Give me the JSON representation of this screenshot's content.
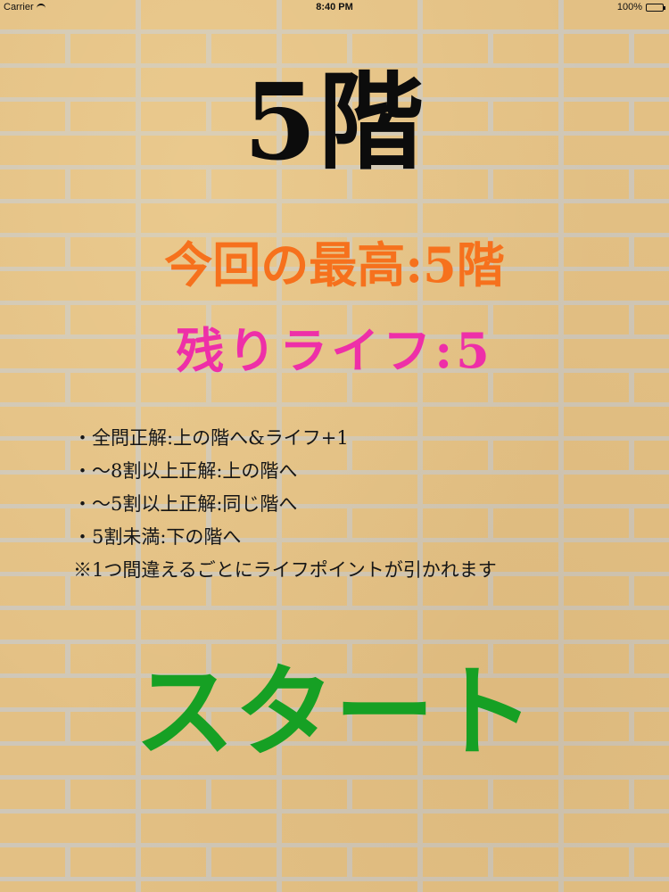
{
  "status_bar": {
    "carrier": "Carrier",
    "time": "8:40 PM",
    "battery": "100%"
  },
  "current_floor": "5階",
  "best_record": "今回の最高:5階",
  "remaining_life": "残りライフ:5",
  "rules": [
    "・全問正解:上の階へ&ライフ+1",
    "・〜8割以上正解:上の階へ",
    "・〜5割以上正解:同じ階へ",
    "・5割未満:下の階へ"
  ],
  "note": "※1つ間違えるごとにライフポイントが引かれます",
  "start_label": "スタート",
  "colors": {
    "floor": "#0c0c0c",
    "best": "#f6711d",
    "life": "#ee2fa8",
    "start": "#16a024",
    "wall": "#e3c084",
    "mortar": "#cfc7b8"
  }
}
